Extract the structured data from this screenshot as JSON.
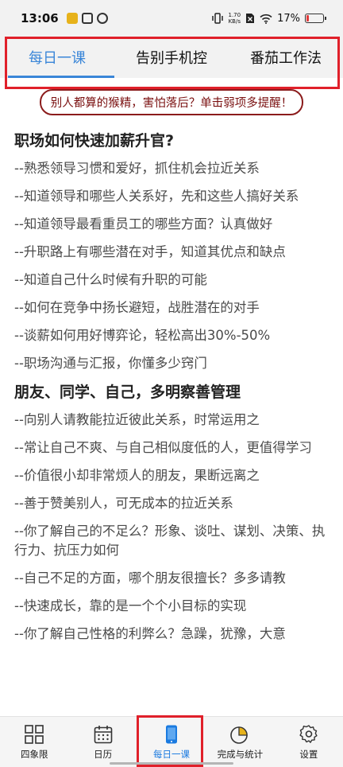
{
  "status_bar": {
    "time": "13:06",
    "net_speed_value": "1.70",
    "net_speed_unit": "KB/s",
    "battery": "17%",
    "battery_fraction": 0.17
  },
  "tabs": [
    {
      "label": "每日一课",
      "active": true
    },
    {
      "label": "告别手机控",
      "active": false
    },
    {
      "label": "番茄工作法",
      "active": false
    }
  ],
  "warning": "别人都算的猴精，害怕落后？单击弱项多提醒！",
  "sections": [
    {
      "title": "职场如何快速加薪升官?",
      "items": [
        "--熟悉领导习惯和爱好，抓住机会拉近关系",
        "--知道领导和哪些人关系好，先和这些人搞好关系",
        "--知道领导最看重员工的哪些方面？认真做好",
        "--升职路上有哪些潜在对手，知道其优点和缺点",
        "--知道自己什么时候有升职的可能",
        "--如何在竞争中扬长避短，战胜潜在的对手",
        "--谈薪如何用好博弈论，轻松高出30%-50%",
        "--职场沟通与汇报，你懂多少窍门"
      ]
    },
    {
      "title": "朋友、同学、自己，多明察善管理",
      "items": [
        "--向别人请教能拉近彼此关系，时常运用之",
        "--常让自己不爽、与自己相似度低的人，更值得学习",
        "--价值很小却非常烦人的朋友，果断远离之",
        "--善于赞美别人，可无成本的拉近关系",
        "--你了解自己的不足么？形象、谈吐、谋划、决策、执行力、抗压力如何",
        "--自己不足的方面，哪个朋友很擅长？多多请教",
        "--快速成长，靠的是一个个小目标的实现",
        "--你了解自己性格的利弊么？急躁，犹豫，大意"
      ]
    }
  ],
  "bottom_nav": [
    {
      "label": "四象限",
      "icon": "grid-icon"
    },
    {
      "label": "日历",
      "icon": "calendar-icon"
    },
    {
      "label": "每日一课",
      "icon": "phone-icon",
      "active": true
    },
    {
      "label": "完成与统计",
      "icon": "pie-chart-icon"
    },
    {
      "label": "设置",
      "icon": "gear-icon"
    }
  ],
  "colors": {
    "accent": "#3a86d8",
    "highlight_frame": "#e0202a",
    "warning_text": "#7a1010"
  }
}
